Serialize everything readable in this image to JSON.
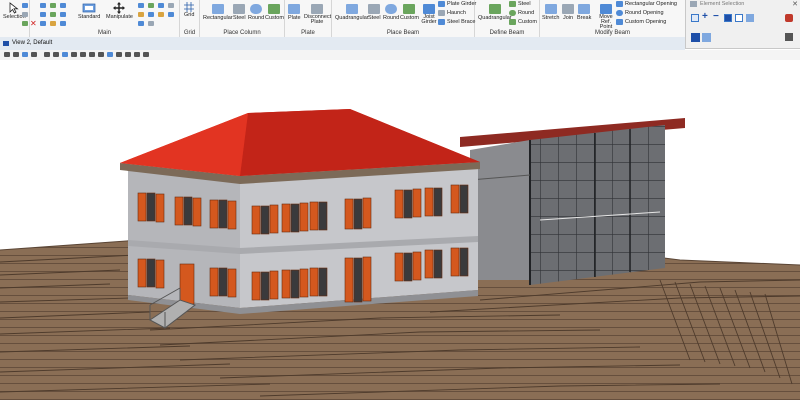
{
  "ribbon": {
    "groups": [
      {
        "title": "",
        "buttons": [
          "Selection"
        ]
      },
      {
        "title": "Main",
        "buttons": [
          "Standard",
          "Manipulate"
        ]
      },
      {
        "title": "Grid",
        "buttons": [
          "Grid"
        ]
      },
      {
        "title": "Place Column",
        "buttons": [
          "Rectangular",
          "Steel",
          "Round",
          "Custom"
        ]
      },
      {
        "title": "Plate",
        "buttons": [
          "Plate",
          "Disconnect Plate"
        ]
      },
      {
        "title": "Place Beam",
        "buttons": [
          "Quadrangular",
          "Steel",
          "Round",
          "Custom",
          "Joist Girder"
        ]
      },
      {
        "title": "Define Beam",
        "buttons": [
          "Quadrangular"
        ]
      },
      {
        "title": "Modify Beam",
        "buttons": [
          "Stretch",
          "Join",
          "Break",
          "Move Ref. Point"
        ]
      }
    ],
    "beam_extras": [
      "Plate Girder",
      "Haunch",
      "Steel Brace"
    ],
    "define_beam_list": [
      "Steel",
      "Round",
      "Custom"
    ],
    "openings": [
      "Rectangular Opening",
      "Round Opening",
      "Custom Opening"
    ]
  },
  "element_selection": {
    "title": "Element Selection"
  },
  "view": {
    "title": "View 2, Default"
  },
  "colors": {
    "roof": "#d12a1b",
    "wall": "#c6c7cb",
    "shutter": "#d4581e",
    "ground": "#8a6e55",
    "ribbon": "#f7f7f7"
  }
}
